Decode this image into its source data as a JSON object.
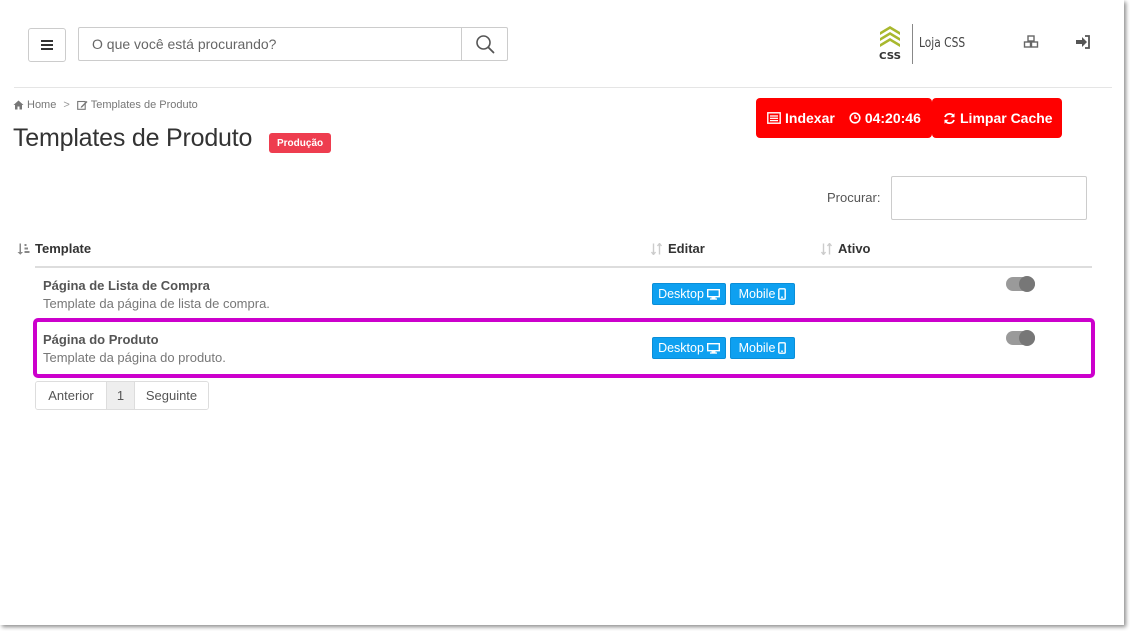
{
  "header": {
    "search_placeholder": "O que você está procurando?",
    "store_name": "Loja CSS",
    "logo_text": "CSS"
  },
  "breadcrumb": {
    "home": "Home",
    "separator": ">",
    "current": "Templates de Produto"
  },
  "page": {
    "title": "Templates de Produto",
    "env_badge": "Produção"
  },
  "actions": {
    "index_label": "Indexar",
    "timer": "04:20:46",
    "cache_label": "Limpar Cache"
  },
  "filter": {
    "label": "Procurar:",
    "value": ""
  },
  "table": {
    "headers": {
      "template": "Template",
      "edit": "Editar",
      "active": "Ativo"
    },
    "rows": [
      {
        "title": "Página de Lista de Compra",
        "description": "Template da página de lista de compra.",
        "desktop": "Desktop",
        "mobile": "Mobile",
        "active": false
      },
      {
        "title": "Página do Produto",
        "description": "Template da página do produto.",
        "desktop": "Desktop",
        "mobile": "Mobile",
        "active": false
      }
    ]
  },
  "pagination": {
    "prev": "Anterior",
    "page": "1",
    "next": "Seguinte"
  },
  "colors": {
    "red": "#ff0000",
    "badge": "#ee3d4f",
    "blue": "#0ea0f0",
    "highlight": "#cc00cc",
    "logo_green": "#a8b82e"
  },
  "icons": [
    "menu-icon",
    "search-icon",
    "cubes-icon",
    "sign-in-icon",
    "home-icon",
    "edit-icon",
    "list-icon",
    "clock-icon",
    "refresh-icon",
    "sort-icon",
    "desktop-icon",
    "mobile-icon"
  ]
}
